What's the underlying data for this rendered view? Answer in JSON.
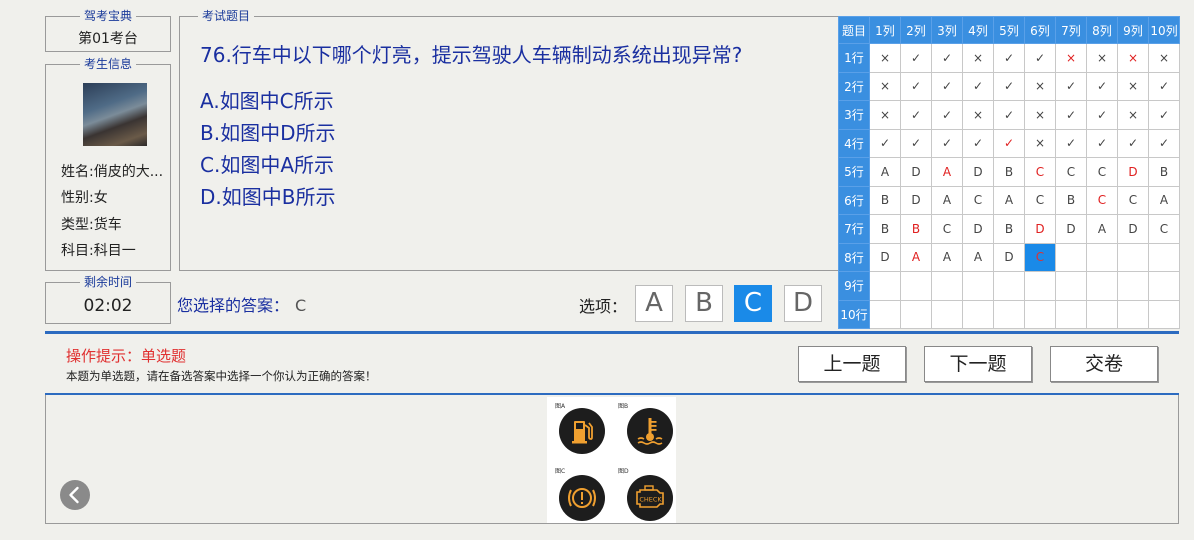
{
  "bank": {
    "legend": "驾考宝典",
    "value": "第01考台"
  },
  "candidate": {
    "legend": "考生信息",
    "name": "姓名:俏皮的大...",
    "gender": "性别:女",
    "type": "类型:货车",
    "subject": "科目:科目一"
  },
  "timer": {
    "legend": "剩余时间",
    "value": "02:02"
  },
  "question": {
    "legend": "考试题目",
    "title": "76.行车中以下哪个灯亮，提示驾驶人车辆制动系统出现异常?",
    "options": [
      "A.如图中C所示",
      "B.如图中D所示",
      "C.如图中A所示",
      "D.如图中B所示"
    ]
  },
  "answer": {
    "label": "您选择的答案：",
    "value": "C"
  },
  "choices": {
    "label": "选项：",
    "items": [
      "A",
      "B",
      "C",
      "D"
    ],
    "selected": "C"
  },
  "grid": {
    "corner": "题目",
    "cols": [
      "1列",
      "2列",
      "3列",
      "4列",
      "5列",
      "6列",
      "7列",
      "8列",
      "9列",
      "10列"
    ],
    "rows": [
      "1行",
      "2行",
      "3行",
      "4行",
      "5行",
      "6行",
      "7行",
      "8行",
      "9行",
      "10行"
    ],
    "cells": [
      [
        "×",
        "✓",
        "✓",
        "×",
        "✓",
        "✓",
        "×",
        "×",
        "×",
        "×"
      ],
      [
        "×",
        "✓",
        "✓",
        "✓",
        "✓",
        "×",
        "✓",
        "✓",
        "×",
        "✓"
      ],
      [
        "×",
        "✓",
        "✓",
        "×",
        "✓",
        "×",
        "✓",
        "✓",
        "×",
        "✓"
      ],
      [
        "✓",
        "✓",
        "✓",
        "✓",
        "✓",
        "×",
        "✓",
        "✓",
        "✓",
        "✓"
      ],
      [
        "A",
        "D",
        "A",
        "D",
        "B",
        "C",
        "C",
        "C",
        "D",
        "B"
      ],
      [
        "B",
        "D",
        "A",
        "C",
        "A",
        "C",
        "B",
        "C",
        "C",
        "A"
      ],
      [
        "B",
        "B",
        "C",
        "D",
        "B",
        "D",
        "D",
        "A",
        "D",
        "C"
      ],
      [
        "D",
        "A",
        "A",
        "A",
        "D",
        "C",
        "",
        "",
        "",
        ""
      ],
      [
        "",
        "",
        "",
        "",
        "",
        "",
        "",
        "",
        "",
        ""
      ],
      [
        "",
        "",
        "",
        "",
        "",
        "",
        "",
        "",
        "",
        ""
      ]
    ],
    "red": [
      [
        0,
        6
      ],
      [
        0,
        8
      ],
      [
        3,
        4
      ],
      [
        4,
        2
      ],
      [
        4,
        5
      ],
      [
        4,
        8
      ],
      [
        5,
        7
      ],
      [
        6,
        1
      ],
      [
        6,
        5
      ],
      [
        7,
        1
      ]
    ],
    "current": [
      7,
      5
    ],
    "accent": "#3a8fe0"
  },
  "hint": {
    "title": "操作提示：单选题",
    "text": "本题为单选题，请在备选答案中选择一个你认为正确的答案！"
  },
  "buttons": {
    "prev": "上一题",
    "next": "下一题",
    "submit": "交卷"
  },
  "figure": {
    "labels": [
      "图A",
      "图B",
      "图C",
      "图D"
    ],
    "lamp_text": "CHECK",
    "lamp_color": "#f0a030"
  }
}
